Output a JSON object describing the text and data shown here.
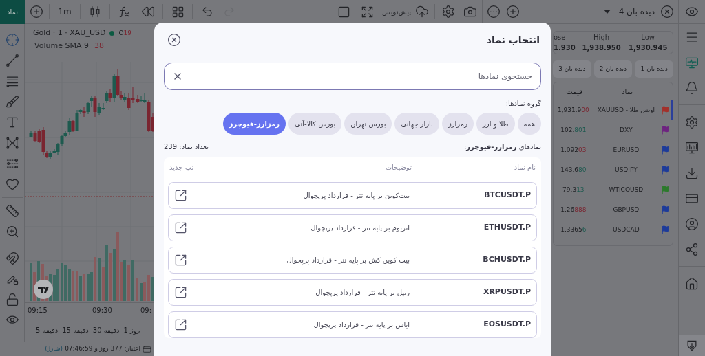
{
  "top_bar": {
    "symbol_button": "نماد",
    "interval": "1m",
    "redo": {
      "disabled": true
    },
    "draft_label": "پیش‌نویس"
  },
  "watchlist_header": {
    "title": "دیده بان 4"
  },
  "chart": {
    "title": "Gold · 1 · XAU_USD",
    "market_open": true,
    "ohlc_label": "O",
    "ohlc_value": "19",
    "indicator": "Volume SMA 9",
    "indicator_value": "38",
    "time_labels": [
      "09:",
      "09:30",
      "09:15"
    ]
  },
  "timeframes": [
    "1 روز",
    "30 دقیقه",
    "15 دقیقه",
    "5 دقیقه"
  ],
  "status_bar": {
    "text": "اعتبار: 377 روز و 07:46:59",
    "link": "(شارژ)"
  },
  "ohlc": [
    {
      "label": "Low",
      "value": "1,930.945"
    },
    {
      "label": "High",
      "value": "1,938.950"
    },
    {
      "label": "ose",
      "value": "1.930"
    }
  ],
  "watchlist_tabs": [
    "دیده بان 1",
    "دیده بان 2",
    "دیده بان 3"
  ],
  "watchlist_table": {
    "columns": [
      "نماد",
      "قیمت"
    ],
    "rows": [
      {
        "symbol": "اونس طلا - XAUUSD",
        "price_head": "1,931.9",
        "price_tail": "00",
        "rising": false,
        "color": "#a3302a",
        "selected": true
      },
      {
        "symbol": "DXY",
        "price_head": "102.",
        "price_tail": "801",
        "rising": true,
        "color": "#6e2380",
        "selected": false
      },
      {
        "symbol": "EURUSD",
        "price_head": "1.092",
        "price_tail": "03",
        "rising": false,
        "color": "#1d3b9a",
        "selected": false
      },
      {
        "symbol": "USDJPY",
        "price_head": "143.6",
        "price_tail": "80",
        "rising": true,
        "color": "#1d3b9a",
        "selected": false
      },
      {
        "symbol": "WTICOUSD",
        "price_head": "79.3",
        "price_tail": "13",
        "rising": true,
        "color": "#2c7a2c",
        "selected": false
      },
      {
        "symbol": "GBPUSD",
        "price_head": "1.26",
        "price_tail": "888",
        "rising": false,
        "color": "#1d3b9a",
        "selected": false
      },
      {
        "symbol": "USDCAD",
        "price_head": "1.3365",
        "price_tail": "6",
        "rising": true,
        "color": "#1d3b9a",
        "selected": false
      }
    ]
  },
  "right_nav": [
    {
      "selected": false
    },
    {
      "selected": true
    },
    {
      "selected": false
    },
    {
      "selected": false
    },
    {
      "selected": false
    },
    {
      "selected": false
    },
    {
      "selected": false
    },
    {
      "selected": false
    },
    {
      "selected": false
    },
    {
      "selected": false
    },
    {
      "selected": false
    }
  ],
  "modal": {
    "title": "انتخاب نماد",
    "search": {
      "placeholder": "جستجوی نمادها"
    },
    "group_label": "گروه نمادها:",
    "groups": [
      {
        "label": "همه",
        "selected": false
      },
      {
        "label": "طلا و ارز",
        "selected": false
      },
      {
        "label": "رمزارز",
        "selected": false
      },
      {
        "label": "بازار جهانی",
        "selected": false
      },
      {
        "label": "بورس تهران",
        "selected": false
      },
      {
        "label": "بورس کالا-آتی",
        "selected": false
      },
      {
        "label": "رمزارز-فیوچرز",
        "selected": true
      }
    ],
    "list_title": "نمادهای **رمزارز-فیوچرز**:",
    "count": "تعداد نماد: 239",
    "columns": [
      "نام نماد",
      "توضیحات",
      "تب جدید"
    ],
    "rows": [
      {
        "symbol": "BTCUSDT.P",
        "description": "بیت‌کوین بر پایه تتر - قرارداد پرپچوال"
      },
      {
        "symbol": "ETHUSDT.P",
        "description": "اتریوم بر پایه تتر - قرارداد پرپچوال"
      },
      {
        "symbol": "BCHUSDT.P",
        "description": "بیت کوین کش بر پایه تتر - قرارداد پرپچوال"
      },
      {
        "symbol": "XRPUSDT.P",
        "description": "ریپل بر پایه تتر - قرارداد پرپچوال"
      },
      {
        "symbol": "EOSUSDT.P",
        "description": "ایاس بر پایه تتر - قرارداد پرپچوال"
      }
    ]
  }
}
